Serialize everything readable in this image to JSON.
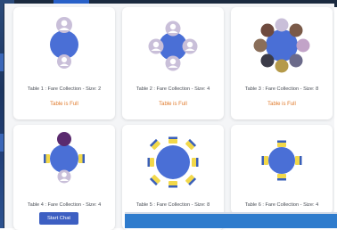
{
  "tables": [
    {
      "caption": "Table 1 : Fare Collection - Size: 2",
      "status": "Table is Full"
    },
    {
      "caption": "Table 2 : Fare Collection - Size: 4",
      "status": "Table is Full"
    },
    {
      "caption": "Table 3 : Fare Collection - Size: 8",
      "status": "Table is Full"
    },
    {
      "caption": "Table 4 : Fare Collection - Size: 4",
      "status": ""
    },
    {
      "caption": "Table 5 : Fare Collection - Size: 8",
      "status": ""
    },
    {
      "caption": "Table 6 : Fare Collection - Size: 4",
      "status": ""
    }
  ],
  "actions": {
    "start_chat_label": "Start Chat"
  },
  "colors": {
    "table": "#4a6fd6",
    "status": "#e07a2b",
    "seat": "#f2d84a",
    "seat_back": "#3a5fb8",
    "avatar": "#c9bfd9",
    "button": "#3d5fc2"
  }
}
